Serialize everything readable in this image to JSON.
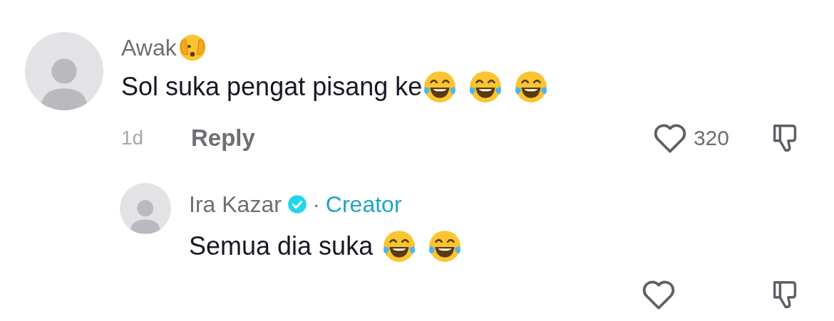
{
  "comments": [
    {
      "author": "Awak",
      "author_emojis": [
        {
          "kind": "peek"
        }
      ],
      "text": "Sol suka pengat pisang ke",
      "text_emojis": [
        {
          "kind": "laugh"
        },
        {
          "kind": "laugh"
        },
        {
          "kind": "laugh"
        }
      ],
      "time": "1d",
      "reply_label": "Reply",
      "likes": "320",
      "liked": false,
      "replies": [
        {
          "author": "Ira Kazar",
          "verified": true,
          "separator": "·",
          "badge": "Creator",
          "text": "Semua dia suka",
          "text_emojis": [
            {
              "kind": "laugh"
            },
            {
              "kind": "laugh"
            }
          ]
        }
      ]
    }
  ]
}
